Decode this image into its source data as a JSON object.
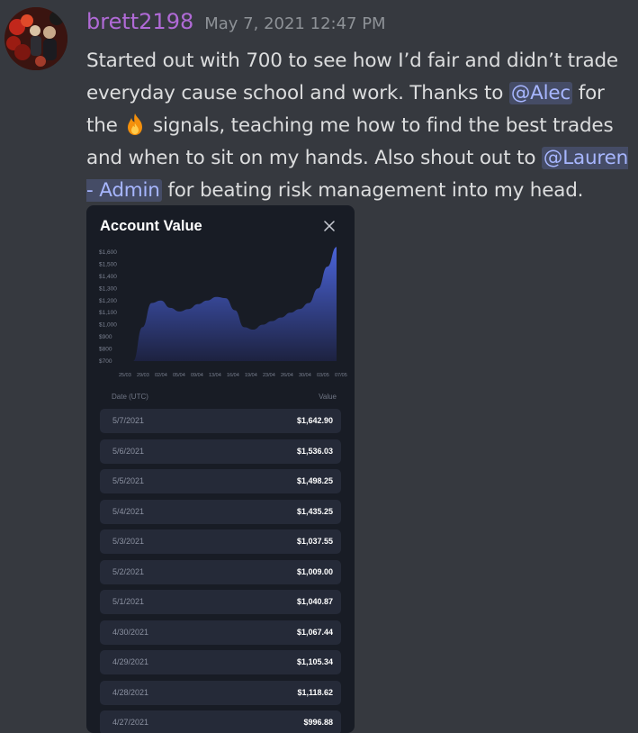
{
  "message": {
    "username": "brett2198",
    "timestamp": "May 7, 2021 12:47 PM",
    "text": {
      "part1": "Started out with 700 to see how I’d fair and didn’t trade everyday cause school and work. Thanks to ",
      "mention1": "@Alec",
      "part2": " for the ",
      "emoji": "fire-emoji",
      "part3": " signals, teaching me how to find the best trades and when to sit on my hands. Also shout out to ",
      "mention2": "@Lauren - Admin",
      "part4": " for beating risk management into my head."
    },
    "colors": {
      "username": "#b06ad6",
      "mention": "#a7b6ff",
      "background": "#36393f"
    }
  },
  "card": {
    "title": "Account Value",
    "close_icon": "close-icon",
    "table_header": {
      "date": "Date (UTC)",
      "value": "Value"
    },
    "rows": [
      {
        "date": "5/7/2021",
        "value": "$1,642.90"
      },
      {
        "date": "5/6/2021",
        "value": "$1,536.03"
      },
      {
        "date": "5/5/2021",
        "value": "$1,498.25"
      },
      {
        "date": "5/4/2021",
        "value": "$1,435.25"
      },
      {
        "date": "5/3/2021",
        "value": "$1,037.55"
      },
      {
        "date": "5/2/2021",
        "value": "$1,009.00"
      },
      {
        "date": "5/1/2021",
        "value": "$1,040.87"
      },
      {
        "date": "4/30/2021",
        "value": "$1,067.44"
      },
      {
        "date": "4/29/2021",
        "value": "$1,105.34"
      },
      {
        "date": "4/28/2021",
        "value": "$1,118.62"
      },
      {
        "date": "4/27/2021",
        "value": "$996.88"
      }
    ]
  },
  "chart_data": {
    "type": "area",
    "title": "Account Value",
    "y_ticks": [
      "$1,600",
      "$1,500",
      "$1,400",
      "$1,300",
      "$1,200",
      "$1,100",
      "$1,000",
      "$900",
      "$800",
      "$700"
    ],
    "x_ticks": [
      "25/03",
      "29/03",
      "02/04",
      "05/04",
      "09/04",
      "13/04",
      "16/04",
      "19/04",
      "23/04",
      "26/04",
      "30/04",
      "03/05",
      "07/05"
    ],
    "ylim": [
      700,
      1600
    ],
    "series": [
      {
        "x": [
          "25/03",
          "27/03",
          "29/03",
          "31/03",
          "02/04",
          "04/04",
          "06/04",
          "08/04",
          "10/04",
          "12/04",
          "14/04",
          "16/04",
          "18/04",
          "20/04",
          "22/04",
          "24/04",
          "26/04",
          "28/04",
          "30/04",
          "02/05",
          "04/05",
          "06/05",
          "07/05"
        ],
        "values": [
          700,
          980,
          1180,
          1200,
          1140,
          1110,
          1130,
          1170,
          1200,
          1230,
          1220,
          1120,
          980,
          960,
          1000,
          1030,
          1060,
          1100,
          1130,
          1180,
          1300,
          1480,
          1642.9
        ]
      }
    ],
    "colors": {
      "fill_top": "#4a63d8",
      "fill_bottom": "#1d2240"
    }
  }
}
